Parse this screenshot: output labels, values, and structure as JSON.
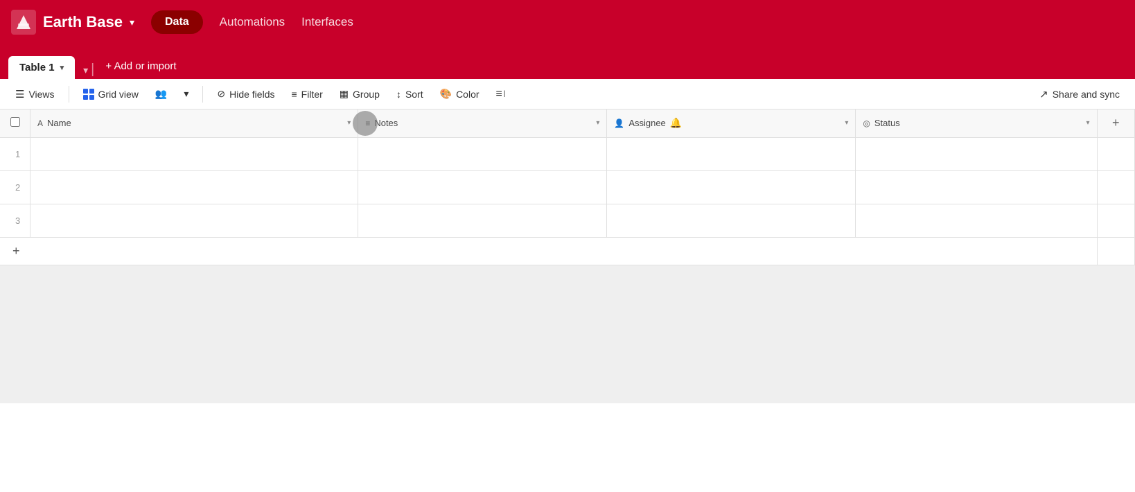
{
  "app": {
    "title": "Earth Base",
    "logo_alt": "logo"
  },
  "nav": {
    "chevron": "▾",
    "data_label": "Data",
    "automations_label": "Automations",
    "interfaces_label": "Interfaces"
  },
  "table_bar": {
    "table_tab_label": "Table 1",
    "tab_chevron": "▾",
    "tab_expand": "▾",
    "divider": "|",
    "add_import_label": "+ Add or import"
  },
  "toolbar": {
    "views_label": "Views",
    "grid_view_label": "Grid view",
    "grid_chevron": "▾",
    "people_icon": "👥",
    "hide_fields_label": "Hide fields",
    "filter_label": "Filter",
    "group_label": "Group",
    "sort_label": "Sort",
    "color_label": "Color",
    "list_icon": "≡",
    "share_sync_label": "Share and sync",
    "share_icon": "↗"
  },
  "columns": [
    {
      "id": "checkbox",
      "label": "",
      "icon": ""
    },
    {
      "id": "name",
      "label": "Name",
      "icon": "A",
      "type": "text"
    },
    {
      "id": "notes",
      "label": "Notes",
      "icon": "≡",
      "type": "text"
    },
    {
      "id": "assignee",
      "label": "Assignee",
      "icon": "👤",
      "type": "person"
    },
    {
      "id": "status",
      "label": "Status",
      "icon": "◎",
      "type": "status"
    },
    {
      "id": "add",
      "label": "+",
      "icon": ""
    }
  ],
  "rows": [
    {
      "num": "1",
      "name": "",
      "notes": "",
      "assignee": "",
      "status": ""
    },
    {
      "num": "2",
      "name": "",
      "notes": "",
      "assignee": "",
      "status": ""
    },
    {
      "num": "3",
      "name": "",
      "notes": "",
      "assignee": "",
      "status": ""
    }
  ],
  "add_row_icon": "+",
  "colors": {
    "brand_red": "#c8002a",
    "dark_red": "#8b0000"
  }
}
